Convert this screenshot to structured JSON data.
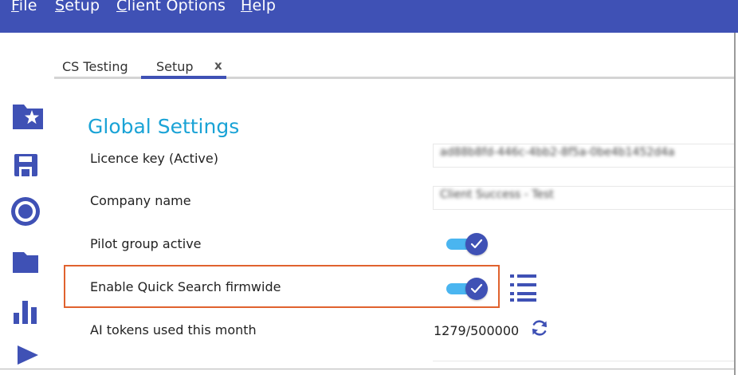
{
  "menu": {
    "file": "File",
    "setup": "Setup",
    "client_options": "Client Options",
    "help": "Help"
  },
  "tabs": [
    {
      "label": "CS Testing"
    },
    {
      "label": "Setup",
      "active": true,
      "close": "x"
    }
  ],
  "sidebar": {
    "icons": [
      "star-folder-icon",
      "save-icon",
      "radio-record-icon",
      "folder-icon",
      "bar-chart-icon",
      "play-icon"
    ]
  },
  "settings": {
    "title": "Global Settings",
    "licence_label": "Licence key (Active)",
    "licence_value": "ad88b8fd-446c-4bb2-8f5a-0be4b1452d4a",
    "company_label": "Company name",
    "company_value": "Client Success - Test",
    "pilot_label": "Pilot group active",
    "pilot_on": true,
    "quick_search_label": "Enable Quick Search firmwide",
    "quick_search_on": true,
    "ai_tokens_label": "AI tokens used this month",
    "ai_tokens_value": "1279/500000"
  },
  "colors": {
    "brand": "#3f51b5",
    "title": "#1aa3d6",
    "toggle_track": "#4ab5f0",
    "highlight": "#e0622e"
  }
}
